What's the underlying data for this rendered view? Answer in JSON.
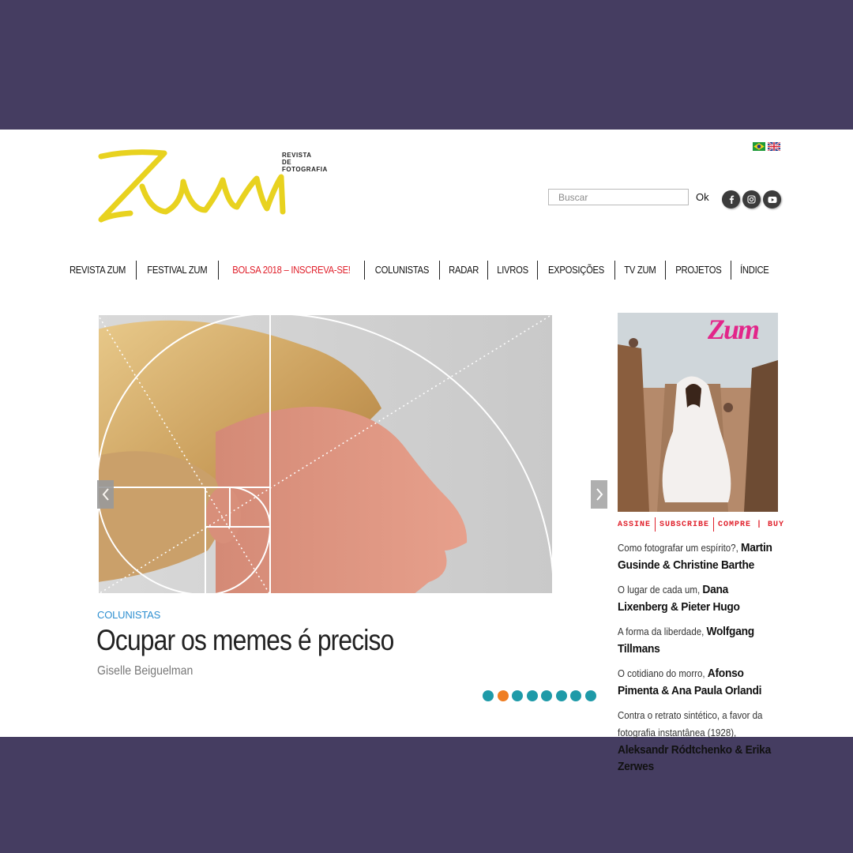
{
  "brand": {
    "logo_text": "Zum",
    "subtitle": [
      "REVISTA",
      "DE",
      "FOTOGRAFIA"
    ]
  },
  "header": {
    "search_placeholder": "Buscar",
    "ok_label": "Ok",
    "languages": [
      "pt-br",
      "en"
    ],
    "social": [
      "facebook-icon",
      "instagram-icon",
      "youtube-icon"
    ]
  },
  "nav": [
    {
      "label": "REVISTA ZUM"
    },
    {
      "label": "FESTIVAL ZUM"
    },
    {
      "label": "BOLSA 2018 – INSCREVA-SE!",
      "highlight": true
    },
    {
      "label": "COLUNISTAS"
    },
    {
      "label": "RADAR"
    },
    {
      "label": "LIVROS"
    },
    {
      "label": "EXPOSIÇÕES"
    },
    {
      "label": "TV ZUM"
    },
    {
      "label": "PROJETOS"
    },
    {
      "label": "ÍNDICE"
    }
  ],
  "hero": {
    "category": "COLUNISTAS",
    "title": "Ocupar os memes é preciso",
    "author": "Giselle Beiguelman",
    "slide_count": 8,
    "active_slide": 2
  },
  "sidebar": {
    "cover_logo": "Zum",
    "buy_links": [
      "ASSINE",
      "SUBSCRIBE",
      "COMPRE | BUY"
    ],
    "articles": [
      {
        "title": "Como fotografar um espírito?, ",
        "authors": "Martin Gusinde & Christine Barthe"
      },
      {
        "title": "O lugar de cada um, ",
        "authors": "Dana Lixenberg & Pieter Hugo"
      },
      {
        "title": "A forma da liberdade, ",
        "authors": "Wolfgang Tillmans"
      },
      {
        "title": "O cotidiano do morro, ",
        "authors": "Afonso Pimenta & Ana Paula Orlandi"
      },
      {
        "title": "Contra o retrato sintético, a favor da fotografia instantânea (1928), ",
        "authors": "Aleksandr Ródtchenko & Erika Zerwes"
      }
    ]
  },
  "colors": {
    "background": "#453d61",
    "accent_red": "#e0202b",
    "logo_yellow": "#e8d21f",
    "dot_teal": "#1e9aa8",
    "dot_active": "#ef7e23",
    "kicker_blue": "#2e8fd0"
  }
}
